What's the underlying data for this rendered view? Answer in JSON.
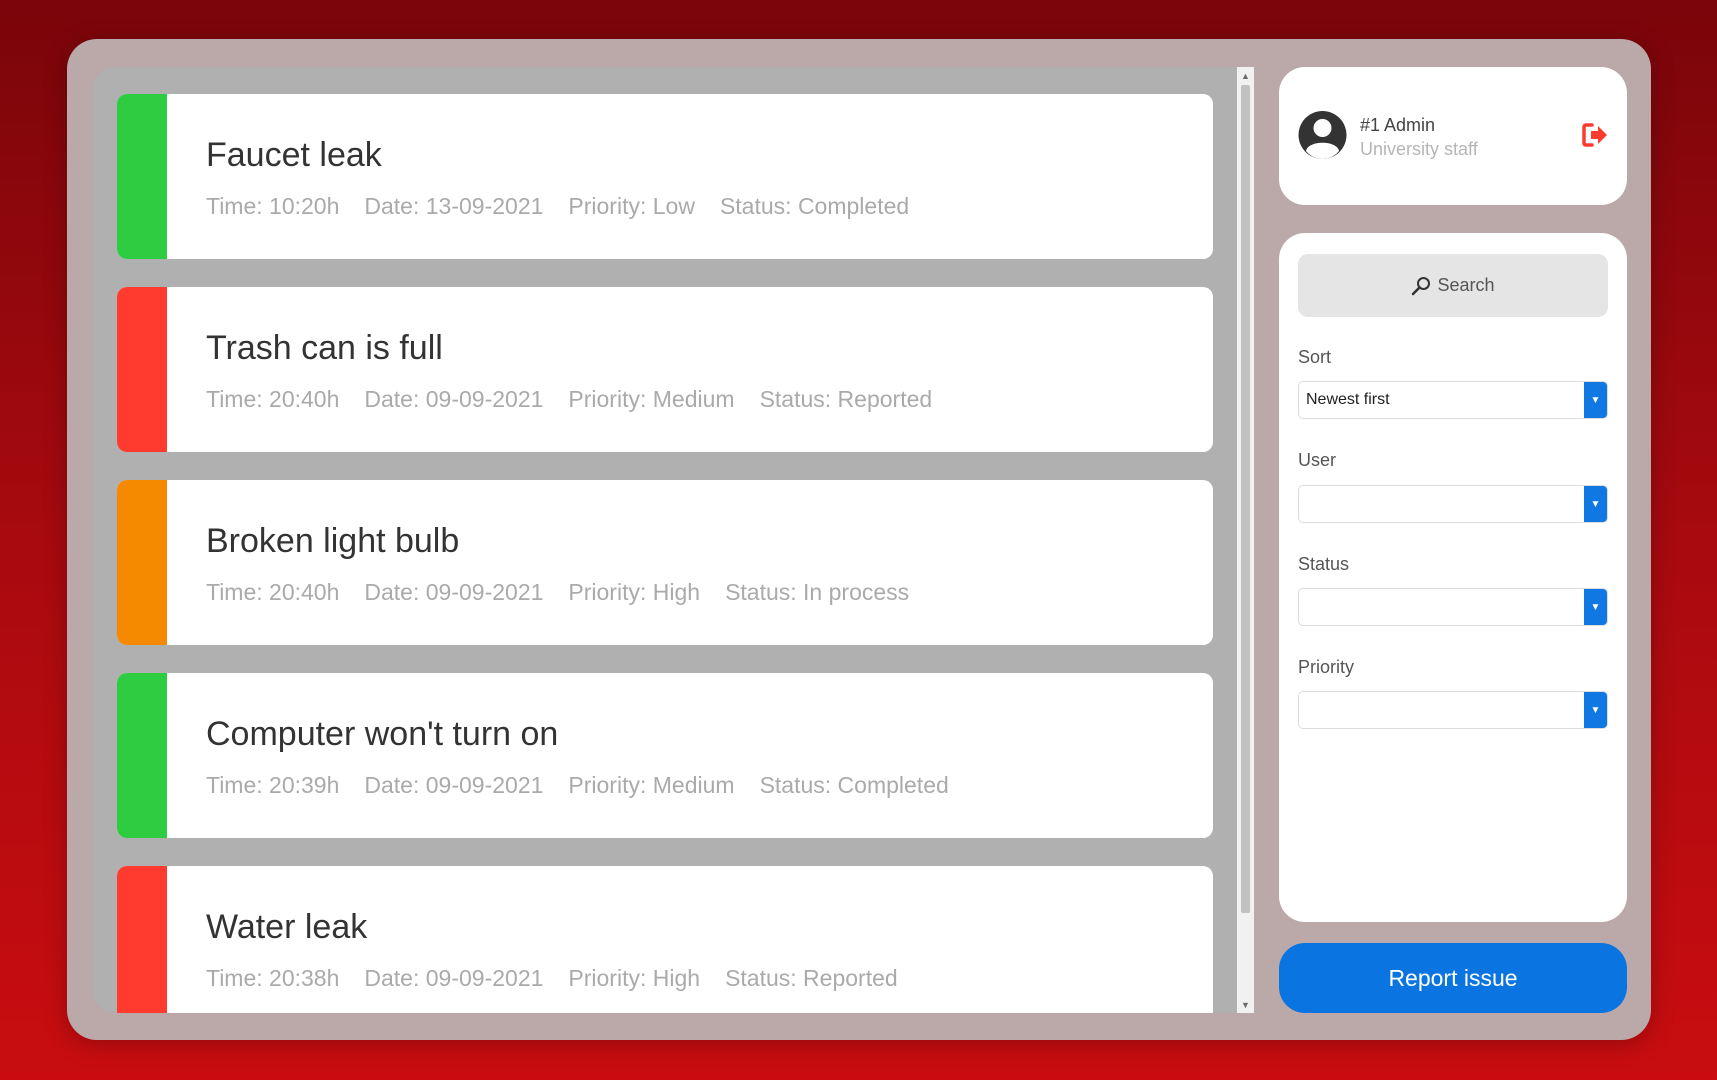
{
  "issues": [
    {
      "title": "Faucet leak",
      "time": "Time: 10:20h",
      "date": "Date: 13-09-2021",
      "priority": "Priority: Low",
      "status": "Status: Completed",
      "color": "#2ecc40"
    },
    {
      "title": "Trash can is full",
      "time": "Time: 20:40h",
      "date": "Date: 09-09-2021",
      "priority": "Priority: Medium",
      "status": "Status: Reported",
      "color": "#ff3b30"
    },
    {
      "title": "Broken light bulb",
      "time": "Time: 20:40h",
      "date": "Date: 09-09-2021",
      "priority": "Priority: High",
      "status": "Status: In process",
      "color": "#f58a00"
    },
    {
      "title": "Computer won't turn on",
      "time": "Time: 20:39h",
      "date": "Date: 09-09-2021",
      "priority": "Priority: Medium",
      "status": "Status: Completed",
      "color": "#2ecc40"
    },
    {
      "title": "Water leak",
      "time": "Time: 20:38h",
      "date": "Date: 09-09-2021",
      "priority": "Priority: High",
      "status": "Status: Reported",
      "color": "#ff3b30"
    }
  ],
  "user": {
    "name": "#1 Admin",
    "role": "University staff",
    "avatar_icon": "user-avatar-icon",
    "logout_icon": "logout-icon"
  },
  "filters": {
    "search_label": "Search",
    "search_icon": "magnifier-icon",
    "sort_label": "Sort",
    "sort_value": "Newest first",
    "user_label": "User",
    "user_value": "",
    "status_label": "Status",
    "status_value": "",
    "priority_label": "Priority",
    "priority_value": ""
  },
  "report_button": "Report issue",
  "colors": {
    "accent": "#0a75e1",
    "completed": "#2ecc40",
    "reported": "#ff3b30",
    "in_process": "#f58a00",
    "logout": "#ff3b30"
  }
}
